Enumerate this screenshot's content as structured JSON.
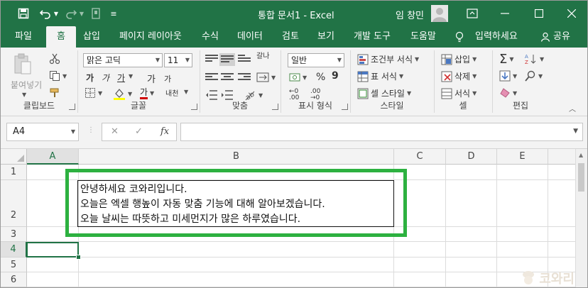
{
  "titlebar": {
    "title": "통합 문서1  -  Excel",
    "user": "임 창민",
    "colors": {
      "brand": "#217346"
    }
  },
  "tabs": [
    {
      "label": "파일"
    },
    {
      "label": "홈"
    },
    {
      "label": "삽입"
    },
    {
      "label": "페이지 레이아웃"
    },
    {
      "label": "수식"
    },
    {
      "label": "데이터"
    },
    {
      "label": "검토"
    },
    {
      "label": "보기"
    },
    {
      "label": "개발 도구"
    },
    {
      "label": "도움말"
    },
    {
      "label": "입력하세요"
    },
    {
      "label": "공유"
    }
  ],
  "ribbon": {
    "clipboard": {
      "paste": "붙여넣기",
      "label": "클립보드"
    },
    "font": {
      "name": "맑은 고딕",
      "size": "11",
      "grow": "가",
      "shrink": "가",
      "bold": "가",
      "italic": "가",
      "underline": "가",
      "font_color": "가",
      "phonetic": "내천",
      "label": "글꼴"
    },
    "alignment": {
      "label": "맞춤",
      "wrap": "갈나"
    },
    "number": {
      "format": "일반",
      "label": "표시 형식"
    },
    "styles": {
      "conditional": "조건부 서식",
      "table": "표 서식",
      "cell_style": "셀 스타일",
      "label": "스타일"
    },
    "cells": {
      "insert": "삽입",
      "delete": "삭제",
      "format": "서식",
      "label": "셀"
    },
    "editing": {
      "label": "편집"
    }
  },
  "formula_bar": {
    "name_box": "A4",
    "fx": "fx",
    "cancel": "✕",
    "enter": "✓",
    "content": ""
  },
  "sheet": {
    "columns": [
      "A",
      "B",
      "C",
      "D",
      "E"
    ],
    "rows": [
      "1",
      "2",
      "3",
      "4",
      "5",
      "6"
    ],
    "selected_column": "A",
    "selected_row": "4",
    "cell_b2_lines": [
      "안녕하세요 코와리입니다.",
      "오늘은 엑셀 행높이 자동 맞춤 기능에 대해 알아보겠습니다.",
      "오늘 날씨는 따뜻하고 미세먼지가 많은 하루였습니다."
    ]
  },
  "watermark": "코와리"
}
